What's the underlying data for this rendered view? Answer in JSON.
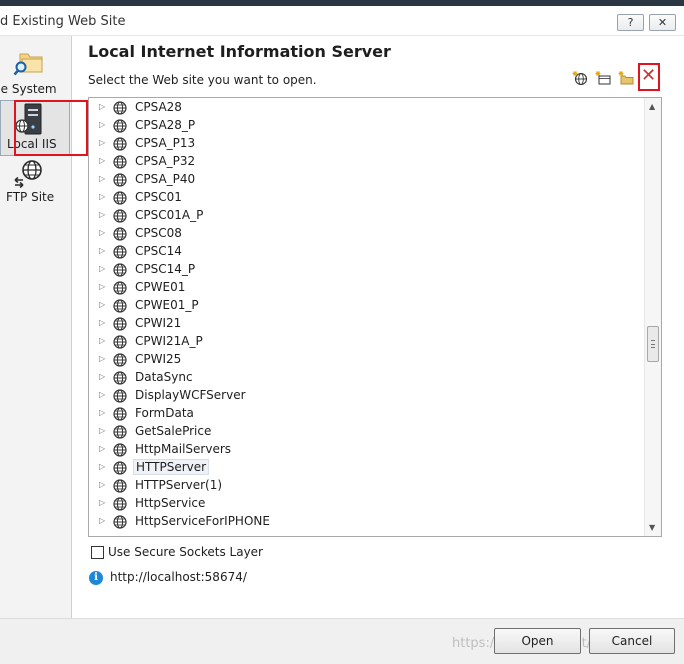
{
  "window": {
    "title": "d Existing Web Site",
    "help_label": "?",
    "close_label": "✕"
  },
  "sidebar": {
    "items": [
      {
        "label": "ile System",
        "icon": "folder-search-icon",
        "selected": false
      },
      {
        "label": "Local IIS",
        "icon": "server-icon",
        "selected": true
      },
      {
        "label": "FTP Site",
        "icon": "globe-transfer-icon",
        "selected": false
      }
    ]
  },
  "main": {
    "heading": "Local Internet Information Server",
    "subheading": "Select the Web site you want to open.",
    "toolbar_icons": [
      "new-web-application-icon",
      "new-virtual-directory-icon",
      "new-folder-icon",
      "delete-icon"
    ],
    "delete_glyph": "✕"
  },
  "tree": {
    "expander_glyph": "▷",
    "items": [
      "CPSA28",
      "CPSA28_P",
      "CPSA_P13",
      "CPSA_P32",
      "CPSA_P40",
      "CPSC01",
      "CPSC01A_P",
      "CPSC08",
      "CPSC14",
      "CPSC14_P",
      "CPWE01",
      "CPWE01_P",
      "CPWI21",
      "CPWI21A_P",
      "CPWI25",
      "DataSync",
      "DisplayWCFServer",
      "FormData",
      "GetSalePrice",
      "HttpMailServers",
      "HTTPServer",
      "HTTPServer(1)",
      "HttpService",
      "HttpServiceForIPHONE"
    ],
    "selected": "HTTPServer"
  },
  "options": {
    "ssl_label": "Use Secure Sockets Layer",
    "ssl_checked": false
  },
  "status": {
    "url": "http://localhost:58674/"
  },
  "footer": {
    "open_label": "Open",
    "cancel_label": "Cancel",
    "watermark": "https://blog.csdn.net/lovesaurus"
  },
  "colors": {
    "highlight_red": "#e0141e",
    "info_blue": "#1e88d8"
  }
}
